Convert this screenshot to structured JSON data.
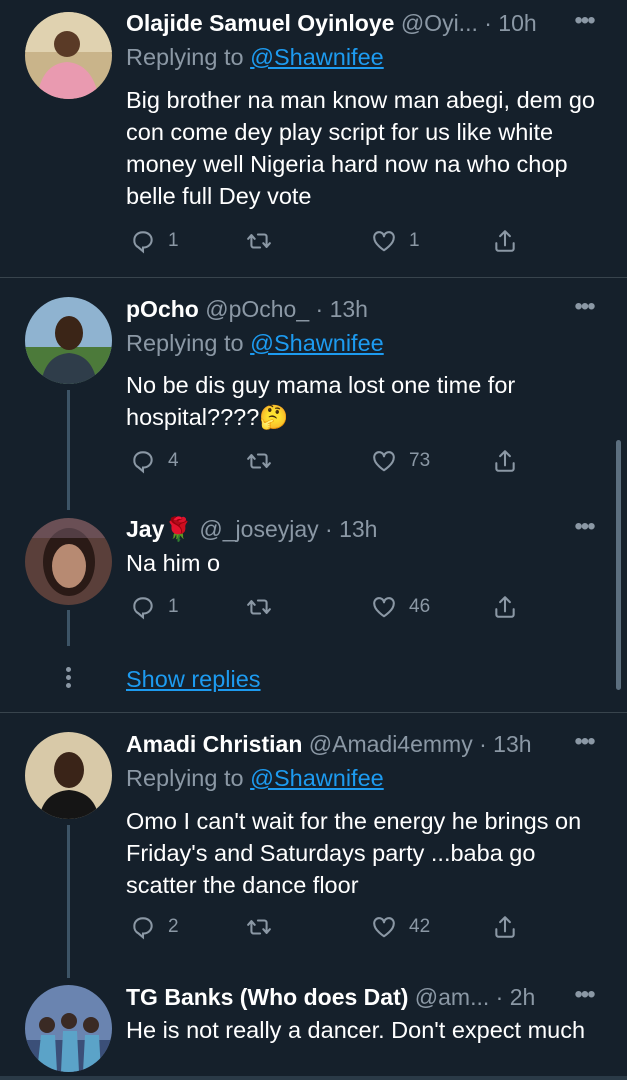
{
  "tweets": [
    {
      "name": "Olajide Samuel Oyinloye",
      "handle": "@Oyi...",
      "time": "· 10h",
      "replying_label": "Replying to",
      "replying_to": "@Shawnifee",
      "text": "Big brother na man know man abegi, dem go con come dey play script for us like white money well Nigeria hard now na who chop belle full Dey vote",
      "replies": "1",
      "retweets": "",
      "likes": "1"
    },
    {
      "name": "pOcho",
      "handle": "@pOcho_",
      "time": "· 13h",
      "replying_label": "Replying to",
      "replying_to": "@Shawnifee",
      "text": "No be dis guy mama lost one time for hospital????🤔",
      "replies": "4",
      "retweets": "",
      "likes": "73"
    },
    {
      "name": "Jay🌹",
      "handle": "@_joseyjay",
      "time": "· 13h",
      "text": "Na him o",
      "replies": "1",
      "retweets": "",
      "likes": "46"
    },
    {
      "name": "Amadi Christian",
      "handle": "@Amadi4emmy",
      "time": "· 13h",
      "replying_label": "Replying to",
      "replying_to": "@Shawnifee",
      "text": "Omo I can't wait for the energy he brings on Friday's and Saturdays party ...baba go scatter the dance floor",
      "replies": "2",
      "retweets": "",
      "likes": "42"
    },
    {
      "name": "TG Banks (Who does Dat)",
      "handle": "@am...",
      "time": "· 2h",
      "text": "He is not really a dancer. Don't expect much"
    }
  ],
  "show_replies": "Show replies",
  "more_label": "•••",
  "icons": {
    "reply": "reply-icon",
    "retweet": "retweet-icon",
    "like": "heart-icon",
    "share": "share-icon"
  },
  "colors": {
    "background": "#15202b",
    "link": "#1d9bf0",
    "muted": "#8b98a5",
    "divider": "#38444d"
  }
}
